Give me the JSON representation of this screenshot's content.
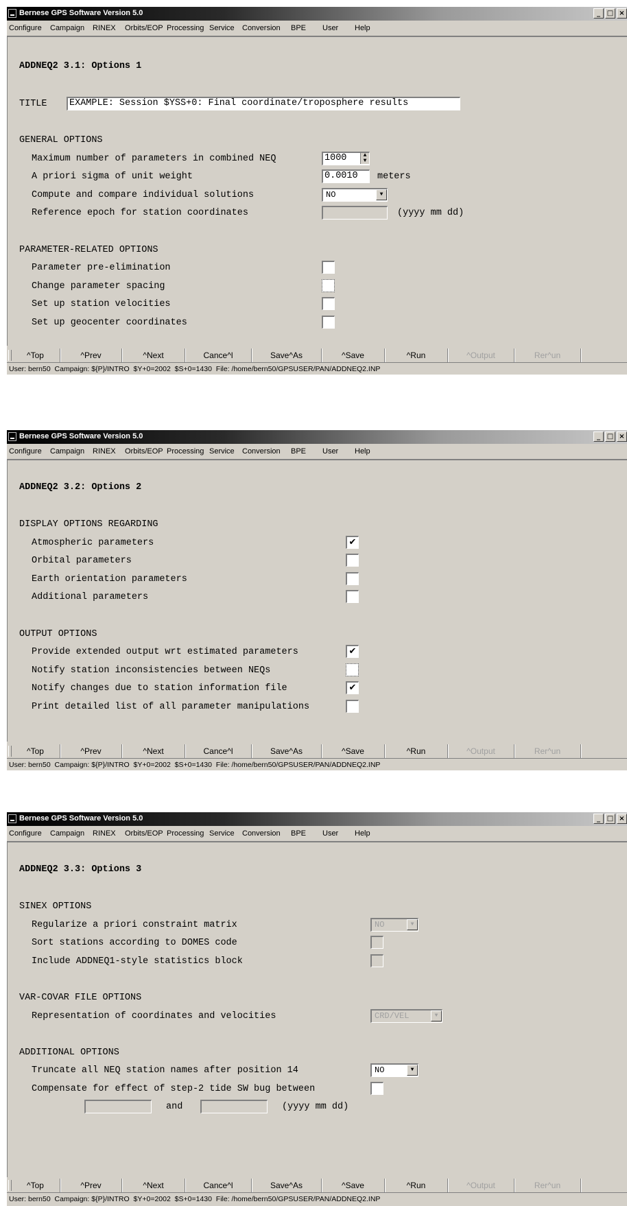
{
  "app_title": "Bernese GPS Software Version 5.0",
  "window_controls": [
    "_",
    "□",
    "×"
  ],
  "menu": [
    "Configure",
    "Campaign",
    "RINEX",
    "Orbits/EOP",
    "Processing",
    "Service",
    "Conversion",
    "BPE",
    "User",
    "Help"
  ],
  "buttons": [
    "^Top",
    "^Prev",
    "^Next",
    "Cance^l",
    "Save^As",
    "^Save",
    "^Run",
    "^Output",
    "Rer^un"
  ],
  "status": "User: bern50  Campaign: ${P}/INTRO  $Y+0=2002  $S+0=1430  File: /home/bern50/GPSUSER/PAN/ADDNEQ2.INP",
  "panel1": {
    "heading": "ADDNEQ2 3.1: Options 1",
    "title_label": "TITLE",
    "title_value": "EXAMPLE: Session $YSS+0: Final coordinate/troposphere results",
    "general_header": "GENERAL OPTIONS",
    "max_params_label": "Maximum number of parameters in combined NEQ",
    "max_params_value": "1000",
    "sigma_label": "A priori sigma of unit weight",
    "sigma_value": "0.0010",
    "sigma_unit": "meters",
    "compare_label": "Compute and compare individual solutions",
    "compare_value": "NO",
    "ref_epoch_label": "Reference epoch for station coordinates",
    "ref_epoch_value": "",
    "ref_epoch_unit": "(yyyy mm dd)",
    "param_header": "PARAMETER-RELATED OPTIONS",
    "pre_elim_label": "Parameter pre-elimination",
    "spacing_label": "Change parameter spacing",
    "velocities_label": "Set up station velocities",
    "geocenter_label": "Set up geocenter coordinates",
    "checks": [
      false,
      false,
      false,
      false
    ]
  },
  "panel2": {
    "heading": "ADDNEQ2 3.2: Options 2",
    "display_header": "DISPLAY OPTIONS REGARDING",
    "atmospheric_label": "Atmospheric parameters",
    "orbital_label": "Orbital parameters",
    "earth_label": "Earth orientation parameters",
    "additional_label": "Additional parameters",
    "output_header": "OUTPUT OPTIONS",
    "extended_label": "Provide extended output wrt estimated parameters",
    "notify_incons_label": "Notify station inconsistencies between NEQs",
    "notify_changes_label": "Notify changes due to station information file",
    "print_label": "Print detailed list of all parameter manipulations",
    "display_checks": [
      true,
      false,
      false,
      false
    ],
    "output_checks": [
      true,
      false,
      true,
      false
    ]
  },
  "panel3": {
    "heading": "ADDNEQ2 3.3: Options 3",
    "sinex_header": "SINEX OPTIONS",
    "regularize_label": "Regularize a priori constraint matrix",
    "regularize_value": "NO",
    "sort_label": "Sort stations according to DOMES code",
    "include_label": "Include ADDNEQ1-style statistics block",
    "varcovar_header": "VAR-COVAR FILE OPTIONS",
    "repr_label": "Representation of coordinates and velocities",
    "repr_value": "CRD/VEL",
    "additional_header": "ADDITIONAL OPTIONS",
    "truncate_label": "Truncate all NEQ station names after position 14",
    "truncate_value": "NO",
    "compensate_label": "Compensate for effect of step-2 tide SW bug between",
    "and_label": "and",
    "date_unit": "(yyyy mm dd)",
    "date_from": "",
    "date_to": ""
  }
}
